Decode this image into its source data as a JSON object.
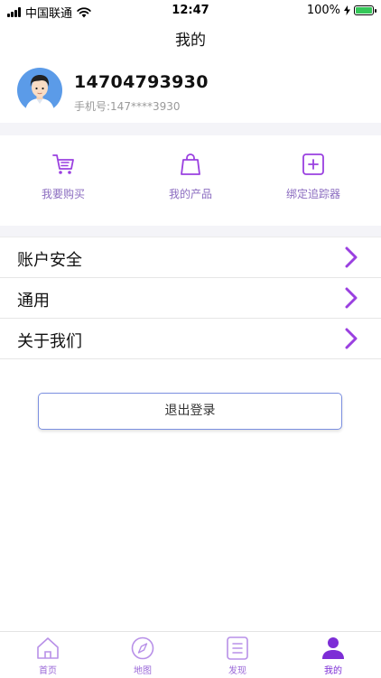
{
  "status_bar": {
    "carrier": "中国联通",
    "time": "12:47",
    "battery": "100%"
  },
  "nav": {
    "title": "我的"
  },
  "profile": {
    "phone": "14704793930",
    "phone_masked": "手机号:147****3930"
  },
  "shortcuts": [
    {
      "label": "我要购买",
      "icon": "cart-icon"
    },
    {
      "label": "我的产品",
      "icon": "bag-icon"
    },
    {
      "label": "绑定追踪器",
      "icon": "plus-square-icon"
    }
  ],
  "menu": [
    {
      "label": "账户安全"
    },
    {
      "label": "通用"
    },
    {
      "label": "关于我们"
    }
  ],
  "logout": {
    "label": "退出登录"
  },
  "tabbar": [
    {
      "label": "首页",
      "icon": "home-icon"
    },
    {
      "label": "地图",
      "icon": "compass-icon"
    },
    {
      "label": "发现",
      "icon": "discover-icon"
    },
    {
      "label": "我的",
      "icon": "person-icon",
      "active": true
    }
  ],
  "colors": {
    "accent": "#9a40e0",
    "accent_light": "#b890e8",
    "logout_border": "#7b8fe0",
    "divider_bg": "#f4f4f8"
  }
}
